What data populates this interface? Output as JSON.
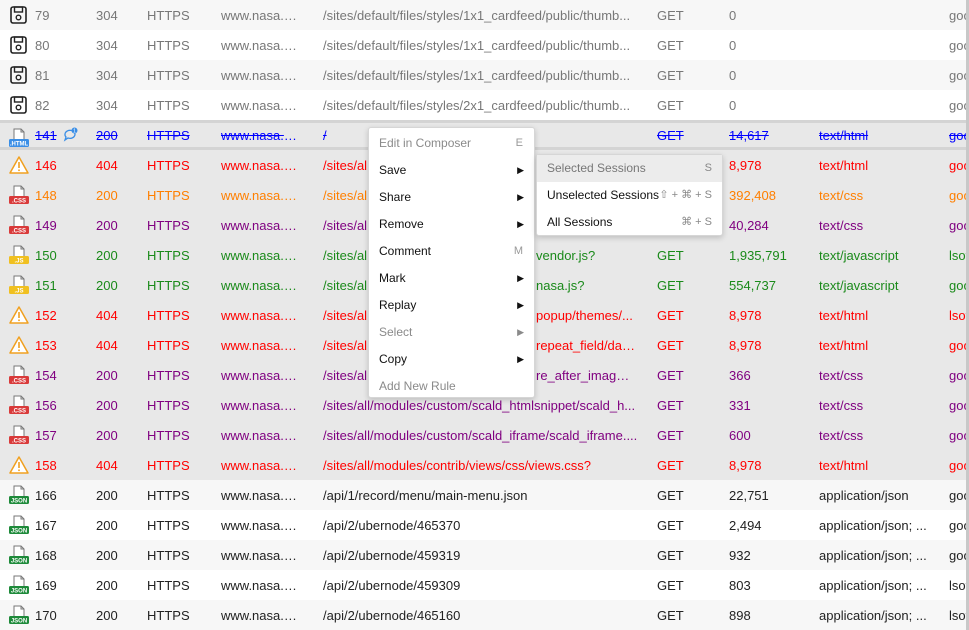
{
  "colors": {
    "gray": "#777777",
    "red": "#ff0000",
    "orange": "#ff7f00",
    "purple": "#800080",
    "green": "#1a8a1a",
    "blue": "#0000ff",
    "black": "#222222"
  },
  "rows": [
    {
      "id": "79",
      "code": "304",
      "proto": "HTTPS",
      "host": "www.nasa.g...",
      "path": "/sites/default/files/styles/1x1_cardfeed/public/thumb...",
      "method": "GET",
      "body": "0",
      "type": "",
      "proc": "goo",
      "icon": "floppy-icon",
      "color": "gray",
      "state": "alt"
    },
    {
      "id": "80",
      "code": "304",
      "proto": "HTTPS",
      "host": "www.nasa.g...",
      "path": "/sites/default/files/styles/1x1_cardfeed/public/thumb...",
      "method": "GET",
      "body": "0",
      "type": "",
      "proc": "goo",
      "icon": "floppy-icon",
      "color": "gray",
      "state": ""
    },
    {
      "id": "81",
      "code": "304",
      "proto": "HTTPS",
      "host": "www.nasa.g...",
      "path": "/sites/default/files/styles/1x1_cardfeed/public/thumb...",
      "method": "GET",
      "body": "0",
      "type": "",
      "proc": "goo",
      "icon": "floppy-icon",
      "color": "gray",
      "state": "alt"
    },
    {
      "id": "82",
      "code": "304",
      "proto": "HTTPS",
      "host": "www.nasa.g...",
      "path": "/sites/default/files/styles/2x1_cardfeed/public/thumb...",
      "method": "GET",
      "body": "0",
      "type": "",
      "proc": "goo",
      "icon": "floppy-icon",
      "color": "gray",
      "state": ""
    },
    {
      "id": "141",
      "code": "200",
      "proto": "HTTPS",
      "host": "www.nasa.g...",
      "path": "/",
      "method": "GET",
      "body": "14,617",
      "type": "text/html",
      "proc": "goo",
      "icon": "html-file-icon",
      "color": "blue",
      "state": "focus",
      "comment_count": "1"
    },
    {
      "id": "146",
      "code": "404",
      "proto": "HTTPS",
      "host": "www.nasa.g...",
      "path": "/sites/al",
      "method": "GET",
      "body": "8,978",
      "type": "text/html",
      "proc": "goo",
      "icon": "warning-icon",
      "color": "red",
      "state": "sel"
    },
    {
      "id": "148",
      "code": "200",
      "proto": "HTTPS",
      "host": "www.nasa.g...",
      "path": "/sites/al",
      "method": "GET",
      "body": "392,408",
      "type": "text/css",
      "proc": "goo",
      "icon": "css-file-icon",
      "color": "orange",
      "state": "sel"
    },
    {
      "id": "149",
      "code": "200",
      "proto": "HTTPS",
      "host": "www.nasa.g...",
      "path": "/sites/al",
      "method": "GET",
      "body": "40,284",
      "type": "text/css",
      "proc": "goo",
      "icon": "css-file-icon",
      "color": "purple",
      "state": "sel"
    },
    {
      "id": "150",
      "code": "200",
      "proto": "HTTPS",
      "host": "www.nasa.g...",
      "path": "/sites/al",
      "path_end": "vendor.js?",
      "method": "GET",
      "body": "1,935,791",
      "type": "text/javascript",
      "proc": "lsof",
      "icon": "js-file-icon",
      "color": "green",
      "state": "sel"
    },
    {
      "id": "151",
      "code": "200",
      "proto": "HTTPS",
      "host": "www.nasa.g...",
      "path": "/sites/al",
      "path_end": "nasa.js?",
      "method": "GET",
      "body": "554,737",
      "type": "text/javascript",
      "proc": "goo",
      "icon": "js-file-icon",
      "color": "green",
      "state": "sel"
    },
    {
      "id": "152",
      "code": "404",
      "proto": "HTTPS",
      "host": "www.nasa.g...",
      "path": "/sites/al",
      "path_end": "popup/themes/...",
      "method": "GET",
      "body": "8,978",
      "type": "text/html",
      "proc": "lsof",
      "icon": "warning-icon",
      "color": "red",
      "state": "sel"
    },
    {
      "id": "153",
      "code": "404",
      "proto": "HTTPS",
      "host": "www.nasa.g...",
      "path": "/sites/al",
      "path_end": "repeat_field/dat...",
      "method": "GET",
      "body": "8,978",
      "type": "text/html",
      "proc": "goo",
      "icon": "warning-icon",
      "color": "red",
      "state": "sel"
    },
    {
      "id": "154",
      "code": "200",
      "proto": "HTTPS",
      "host": "www.nasa.g...",
      "path": "/sites/al",
      "path_end": "re_after_image/...",
      "method": "GET",
      "body": "366",
      "type": "text/css",
      "proc": "goo",
      "icon": "css-file-icon",
      "color": "purple",
      "state": "sel"
    },
    {
      "id": "156",
      "code": "200",
      "proto": "HTTPS",
      "host": "www.nasa.g...",
      "path": "/sites/all/modules/custom/scald_htmlsnippet/scald_h...",
      "method": "GET",
      "body": "331",
      "type": "text/css",
      "proc": "goo",
      "icon": "css-file-icon",
      "color": "purple",
      "state": "sel"
    },
    {
      "id": "157",
      "code": "200",
      "proto": "HTTPS",
      "host": "www.nasa.g...",
      "path": "/sites/all/modules/custom/scald_iframe/scald_iframe....",
      "method": "GET",
      "body": "600",
      "type": "text/css",
      "proc": "goo",
      "icon": "css-file-icon",
      "color": "purple",
      "state": "sel"
    },
    {
      "id": "158",
      "code": "404",
      "proto": "HTTPS",
      "host": "www.nasa.g...",
      "path": "/sites/all/modules/contrib/views/css/views.css?",
      "method": "GET",
      "body": "8,978",
      "type": "text/html",
      "proc": "goo",
      "icon": "warning-icon",
      "color": "red",
      "state": "sel"
    },
    {
      "id": "166",
      "code": "200",
      "proto": "HTTPS",
      "host": "www.nasa.g...",
      "path": "/api/1/record/menu/main-menu.json",
      "method": "GET",
      "body": "22,751",
      "type": "application/json",
      "proc": "goo",
      "icon": "json-file-icon",
      "color": "black",
      "state": "alt"
    },
    {
      "id": "167",
      "code": "200",
      "proto": "HTTPS",
      "host": "www.nasa.g...",
      "path": "/api/2/ubernode/465370",
      "method": "GET",
      "body": "2,494",
      "type": "application/json; ...",
      "proc": "goo",
      "icon": "json-file-icon",
      "color": "black",
      "state": ""
    },
    {
      "id": "168",
      "code": "200",
      "proto": "HTTPS",
      "host": "www.nasa.g...",
      "path": "/api/2/ubernode/459319",
      "method": "GET",
      "body": "932",
      "type": "application/json; ...",
      "proc": "goo",
      "icon": "json-file-icon",
      "color": "black",
      "state": "alt"
    },
    {
      "id": "169",
      "code": "200",
      "proto": "HTTPS",
      "host": "www.nasa.g...",
      "path": "/api/2/ubernode/459309",
      "method": "GET",
      "body": "803",
      "type": "application/json; ...",
      "proc": "lsof",
      "icon": "json-file-icon",
      "color": "black",
      "state": ""
    },
    {
      "id": "170",
      "code": "200",
      "proto": "HTTPS",
      "host": "www.nasa.g...",
      "path": "/api/2/ubernode/465160",
      "method": "GET",
      "body": "898",
      "type": "application/json; ...",
      "proc": "lsof",
      "icon": "json-file-icon",
      "color": "black",
      "state": "alt"
    }
  ],
  "context_menu": {
    "items": [
      {
        "label": "Edit in Composer",
        "shortcut": "E",
        "disabled": true,
        "submenu": false
      },
      {
        "label": "Save",
        "shortcut": "",
        "disabled": false,
        "submenu": true
      },
      {
        "label": "Share",
        "shortcut": "",
        "disabled": false,
        "submenu": true
      },
      {
        "label": "Remove",
        "shortcut": "",
        "disabled": false,
        "submenu": true
      },
      {
        "label": "Comment",
        "shortcut": "M",
        "disabled": false,
        "submenu": false
      },
      {
        "label": "Mark",
        "shortcut": "",
        "disabled": false,
        "submenu": true
      },
      {
        "label": "Replay",
        "shortcut": "",
        "disabled": false,
        "submenu": true
      },
      {
        "label": "Select",
        "shortcut": "",
        "disabled": true,
        "submenu": true
      },
      {
        "label": "Copy",
        "shortcut": "",
        "disabled": false,
        "submenu": true
      },
      {
        "label": "Add New Rule",
        "shortcut": "",
        "disabled": true,
        "submenu": false
      }
    ]
  },
  "save_submenu": {
    "items": [
      {
        "label": "Selected Sessions",
        "shortcut": "S",
        "highlighted": true
      },
      {
        "label": "Unselected Sessions",
        "shortcut": "⇧ + ⌘ + S",
        "highlighted": false
      },
      {
        "label": "All Sessions",
        "shortcut": "⌘ + S",
        "highlighted": false
      }
    ]
  }
}
